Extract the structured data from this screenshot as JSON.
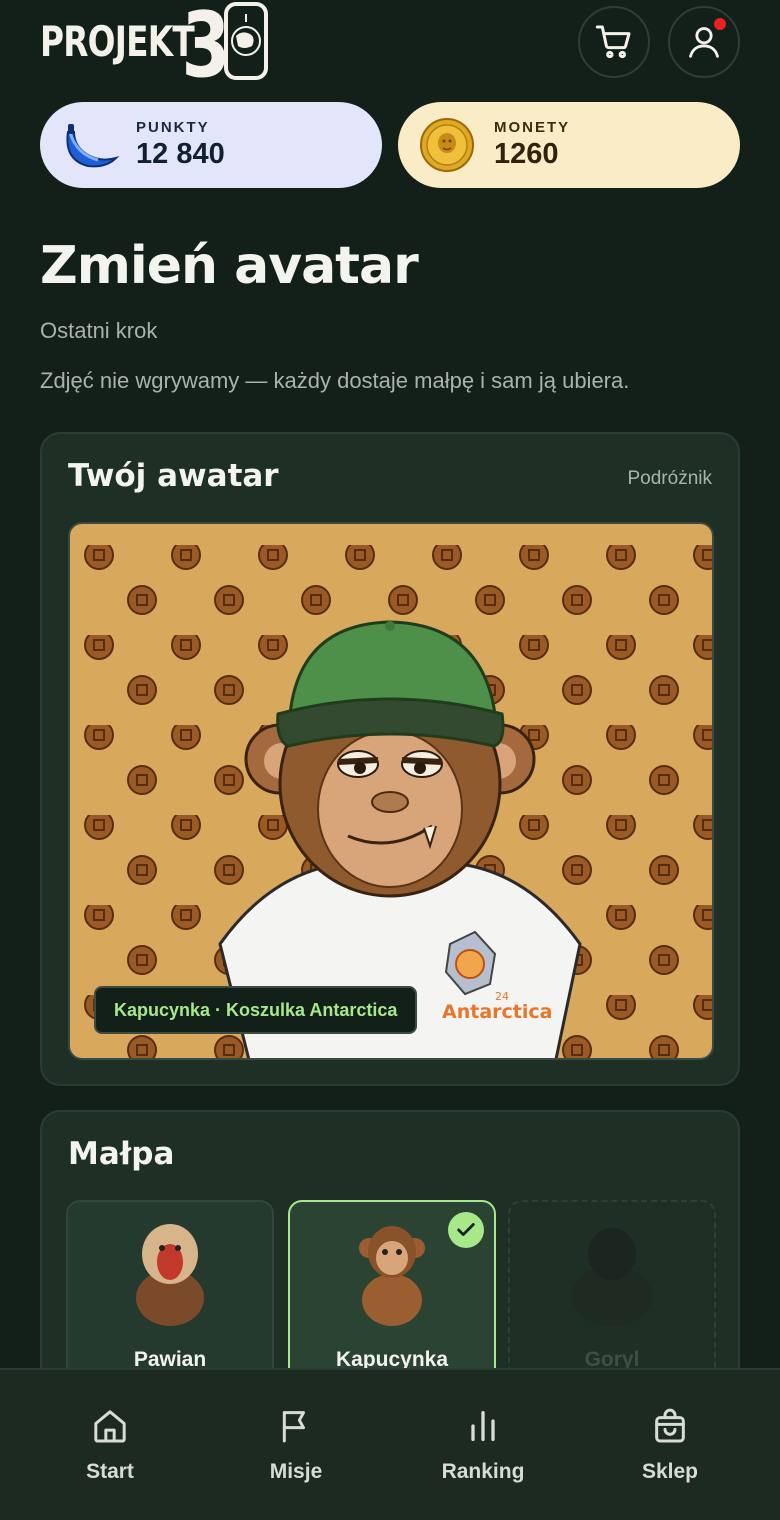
{
  "brand": {
    "word": "PROJEKT",
    "number": "30"
  },
  "header": {
    "cart_icon": "cart-icon",
    "user_icon": "user-icon",
    "has_notification": true
  },
  "balances": {
    "points": {
      "label": "PUNKTY",
      "value": "12 840",
      "icon": "banana-icon",
      "color": "#e3e6fb"
    },
    "coins": {
      "label": "MONETY",
      "value": "1260",
      "icon": "monkey-coin-icon",
      "color": "#f9ecc6"
    }
  },
  "page": {
    "title": "Zmień avatar",
    "subtitle": "Ostatni krok",
    "description": "Zdjęć nie wgrywamy — każdy dostaje małpę i sam ją ubiera."
  },
  "avatar_card": {
    "title": "Twój awatar",
    "tag": "Podróżnik",
    "caption": "Kapucynka · Koszulka Antarctica",
    "shirt_text": "Antarctica",
    "shirt_year": "24"
  },
  "monkey_card": {
    "title": "Małpa",
    "options": [
      {
        "label": "Pawian",
        "selected": false,
        "locked": false
      },
      {
        "label": "Kapucynka",
        "selected": true,
        "locked": false
      },
      {
        "label": "Goryl",
        "selected": false,
        "locked": true
      }
    ]
  },
  "nav": [
    {
      "label": "Start",
      "icon": "home-icon"
    },
    {
      "label": "Misje",
      "icon": "flag-icon"
    },
    {
      "label": "Ranking",
      "icon": "bar-chart-icon"
    },
    {
      "label": "Sklep",
      "icon": "shopping-bag-icon"
    }
  ],
  "colors": {
    "accent": "#a7e88b",
    "background": "#13201a",
    "card": "#1e2f26"
  }
}
